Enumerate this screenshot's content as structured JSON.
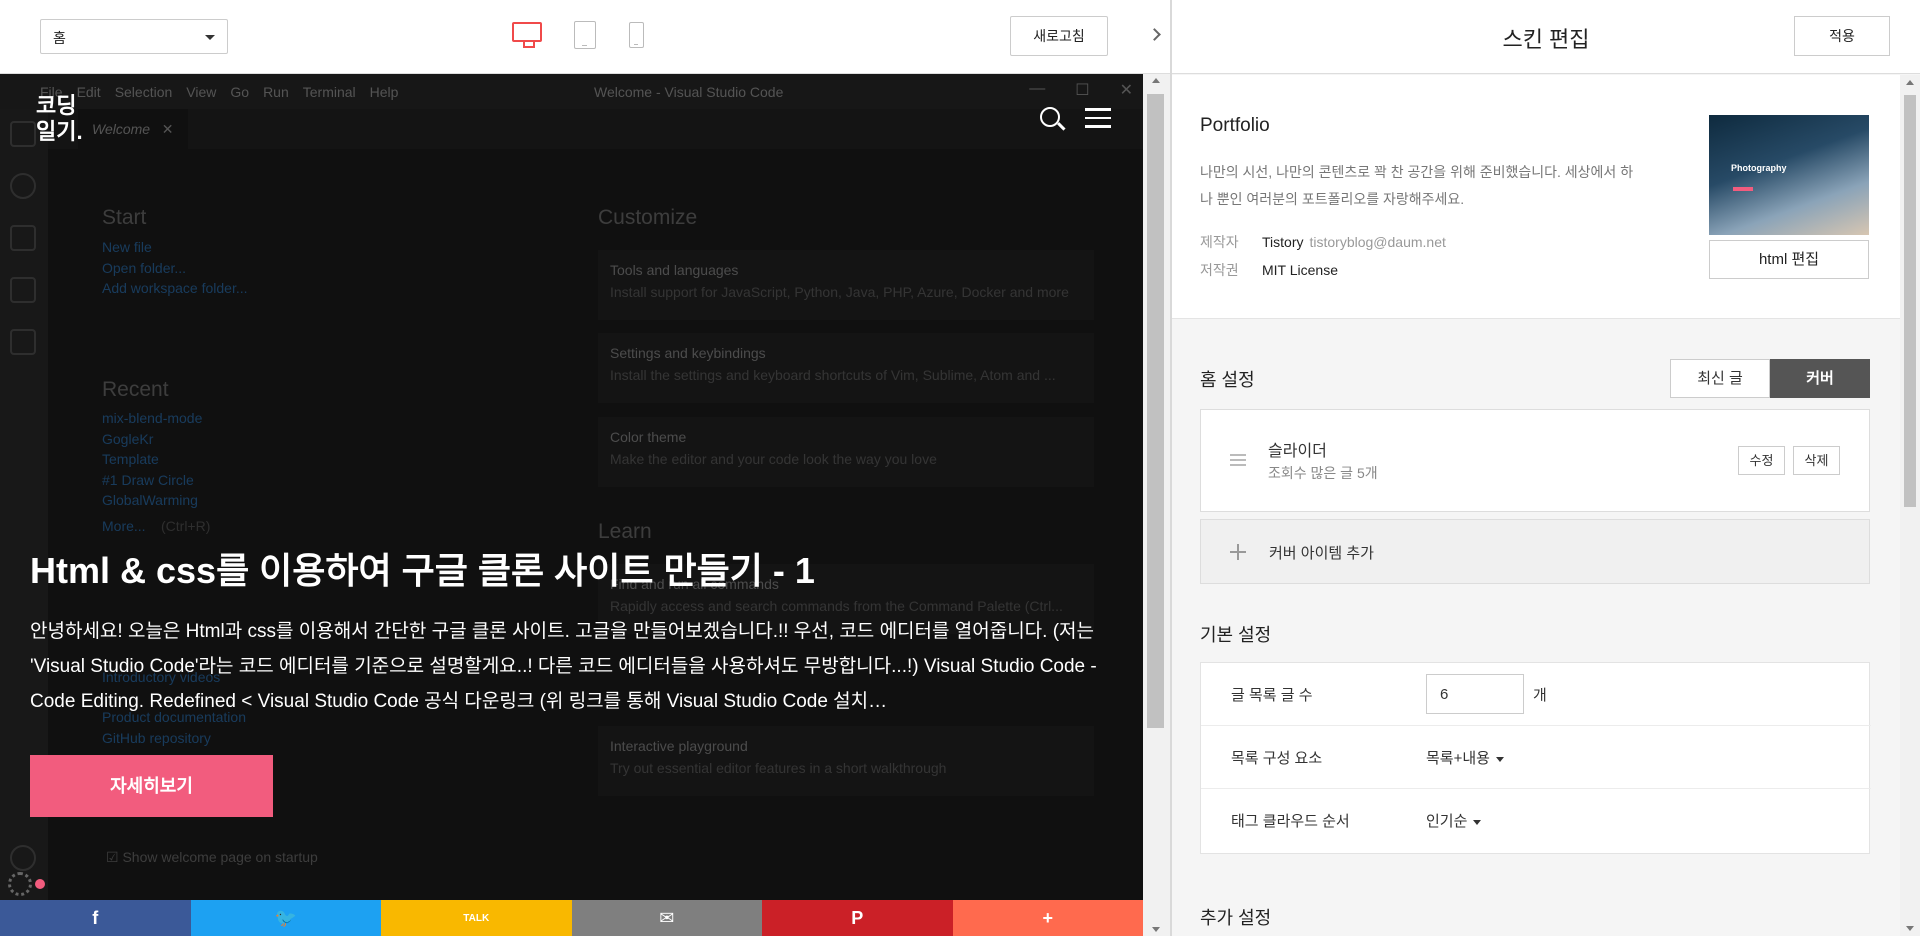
{
  "toolbar": {
    "page_select": "홈",
    "refresh_label": "새로고침"
  },
  "vscode_bg": {
    "menu": [
      "File",
      "Edit",
      "Selection",
      "View",
      "Go",
      "Run",
      "Terminal",
      "Help"
    ],
    "window_title": "Welcome - Visual Studio Code",
    "tab_label": "Welcome",
    "start_title": "Start",
    "start_links": [
      "New file",
      "Open folder...",
      "Add workspace folder..."
    ],
    "recent_title": "Recent",
    "recent_items": [
      "mix-blend-mode",
      "GogleKr",
      "Template",
      "#1 Draw Circle",
      "GlobalWarming"
    ],
    "recent_more": "More...",
    "recent_more_shortcut": "(Ctrl+R)",
    "customize_title": "Customize",
    "cards": [
      {
        "title": "Tools and languages",
        "desc": "Install support for JavaScript, Python, Java, PHP, Azure, Docker and more"
      },
      {
        "title": "Settings and keybindings",
        "desc": "Install the settings and keyboard shortcuts of Vim, Sublime, Atom and ..."
      },
      {
        "title": "Color theme",
        "desc": "Make the editor and your code look the way you love"
      }
    ],
    "learn_title": "Learn",
    "learn_card_title": "Find and run all commands",
    "learn_card_desc": "Rapidly access and search commands from the Command Palette (Ctrl...",
    "play_title": "Interactive playground",
    "play_desc": "Try out essential editor features in a short walkthrough",
    "help_links": [
      "Introductory videos",
      "Product documentation",
      "GitHub repository"
    ],
    "show_welcome": "Show welcome page on startup"
  },
  "blog": {
    "logo": "코딩\n일기.",
    "hero_title": "Html & css를 이용하여 구글 클론 사이트 만들기 - 1",
    "hero_desc": "안녕하세요! 오늘은 Html과 css를 이용해서 간단한 구글 클론 사이트. 고글을 만들어보겠습니다.!! 우선, 코드 에디터를 열어줍니다. (저는 'Visual Studio Code'라는 코드 에디터를 기준으로 설명할게요..! 다른 코드 에디터들을 사용하셔도 무방합니다...!)  Visual Studio Code - Code Editing. Redefined < Visual Studio Code 공식 다운링크 (위 링크를 통해 Visual Studio Code 설치…",
    "hero_button": "자세히보기",
    "share": [
      {
        "icon": "facebook-icon",
        "glyph": "f",
        "color": "#3b5998"
      },
      {
        "icon": "twitter-icon",
        "glyph": "🐦",
        "color": "#1da1f2"
      },
      {
        "icon": "kakaotalk-icon",
        "glyph": "TALK",
        "color": "#f9b800"
      },
      {
        "icon": "mail-icon",
        "glyph": "✉",
        "color": "#7f7f7f"
      },
      {
        "icon": "pinterest-icon",
        "glyph": "P",
        "color": "#cb2027"
      },
      {
        "icon": "more-plus-icon",
        "glyph": "+",
        "color": "#ff6a4e"
      }
    ]
  },
  "panel": {
    "title": "스킨 편집",
    "apply_label": "적용",
    "skin_name": "Portfolio",
    "skin_desc": "나만의 시선, 나만의 콘텐츠로 꽉 찬 공간을 위해 준비했습니다. 세상에서 하나 뿐인 여러분의 포트폴리오를 자랑해주세요.",
    "maker_key": "제작자",
    "maker_value": "Tistory",
    "maker_email": "tistoryblog@daum.net",
    "license_key": "저작권",
    "license_value": "MIT License",
    "thumb_title": "Photography",
    "html_edit_label": "html 편집",
    "home_settings_title": "홈 설정",
    "home_tabs": [
      "최신 글",
      "커버"
    ],
    "cover_item_name": "슬라이더",
    "cover_item_sub": "조회수 많은 글 5개",
    "edit_label": "수정",
    "delete_label": "삭제",
    "add_cover_label": "커버 아이템 추가",
    "basic_title": "기본 설정",
    "post_count_label": "글 목록 글 수",
    "post_count_value": "6",
    "post_count_unit": "개",
    "list_component_label": "목록 구성 요소",
    "list_component_value": "목록+내용",
    "tag_order_label": "태그 클라우드 순서",
    "tag_order_value": "인기순",
    "extra_title": "추가 설정"
  }
}
